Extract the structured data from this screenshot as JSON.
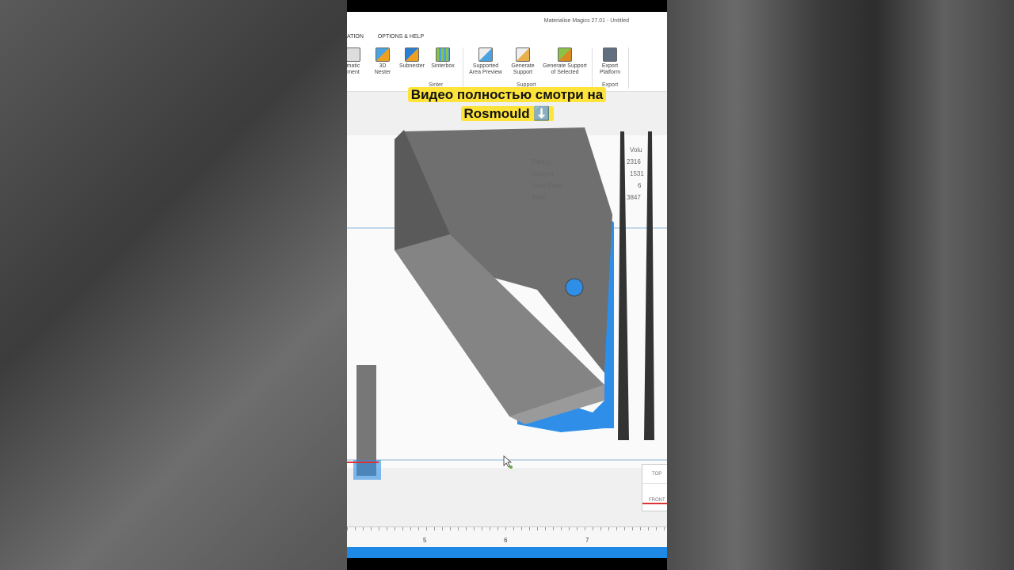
{
  "window_title": "Materialise Magics 27.01 - Untitled",
  "tabs": [
    "ATION",
    "OPTIONS & HELP"
  ],
  "ribbon": {
    "buttons": [
      {
        "label": "matic\nment",
        "icon": "automatic-placement-icon"
      },
      {
        "label": "3D\nNester",
        "icon": "3d-nester-icon"
      },
      {
        "label": "Subnester",
        "icon": "subnester-icon"
      },
      {
        "label": "Sinterbox",
        "icon": "sinterbox-icon"
      },
      {
        "label": "Supported\nArea Preview",
        "icon": "supported-area-preview-icon"
      },
      {
        "label": "Generate\nSupport",
        "icon": "generate-support-icon"
      },
      {
        "label": "Generate Support\nof Selected",
        "icon": "generate-support-selected-icon"
      },
      {
        "label": "Export\nPlatform",
        "icon": "export-platform-icon"
      }
    ],
    "groups": [
      "Sinter",
      "Support",
      "Export"
    ]
  },
  "caption": {
    "line1": "Видео полностью смотри на",
    "line2": "Rosmould ⬇️"
  },
  "stats": {
    "header": "Volu",
    "rows": [
      {
        "label": "Part(s)",
        "value": "2316"
      },
      {
        "label": "Support",
        "value": "1531"
      },
      {
        "label": "Base Plate",
        "value": "6"
      },
      {
        "label": "Total",
        "value": "3847"
      }
    ]
  },
  "view_cube": {
    "top": "TOP",
    "front": "FRONT"
  },
  "ruler": [
    "5",
    "6",
    "7"
  ],
  "colors": {
    "support": "#1e88e5",
    "caption_bg": "#fde33a"
  }
}
